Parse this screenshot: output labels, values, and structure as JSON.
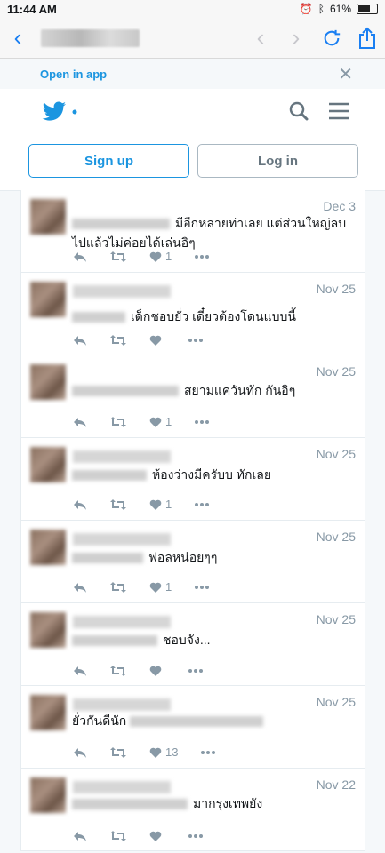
{
  "status": {
    "time": "11:44 AM",
    "battery": "61%"
  },
  "banner": {
    "open_app": "Open in app"
  },
  "auth": {
    "signup": "Sign up",
    "login": "Log in"
  },
  "tweets": [
    {
      "date": "Dec 3",
      "text": "มีอีกหลายท่าเลย แต่ส่วนใหญ่ลบไปแล้วไม่ค่อยได้เล่นอิๆ",
      "likes": "1"
    },
    {
      "date": "Nov 25",
      "text": "เด็กชอบยั่ว เดี๋ยวต้องโดนแบบนี้",
      "likes": ""
    },
    {
      "date": "Nov 25",
      "text": "สยามแควันทัก กันอิๆ",
      "likes": "1"
    },
    {
      "date": "Nov 25",
      "text": "ห้องว่างมีครับบ ทักเลย",
      "likes": "1"
    },
    {
      "date": "Nov 25",
      "text": "ฟอลหน่อยๆๆ",
      "likes": "1"
    },
    {
      "date": "Nov 25",
      "text": "ชอบจัง...",
      "likes": ""
    },
    {
      "date": "Nov 25",
      "text": "ยั่วกันดีนัก",
      "likes": "13"
    },
    {
      "date": "Nov 22",
      "text": "มากรุงเทพยัง",
      "likes": ""
    }
  ]
}
